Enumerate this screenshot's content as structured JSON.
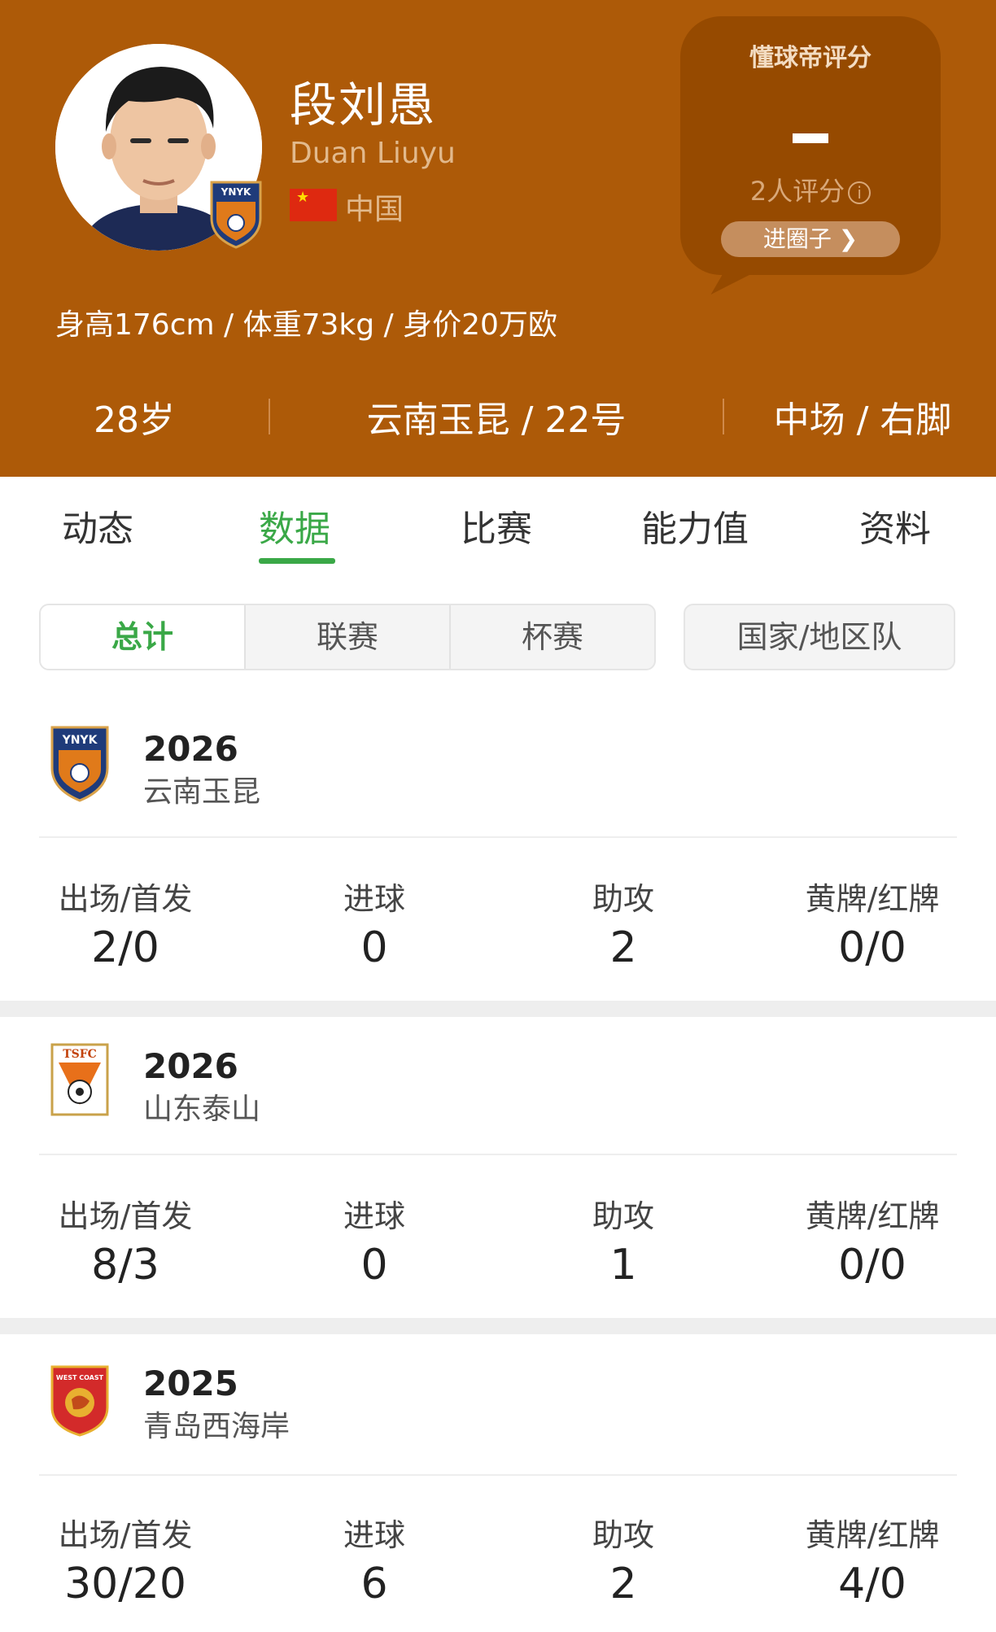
{
  "player": {
    "name_cn": "段刘愚",
    "name_en": "Duan Liuyu",
    "country": "中国",
    "body_stats": "身高176cm / 体重73kg / 身价20万欧",
    "age": "28岁",
    "team_number": "云南玉昆 / 22号",
    "position_foot": "中场 / 右脚",
    "badge_text": "YNYK"
  },
  "rating": {
    "title": "懂球帝评分",
    "value": "-",
    "count": "2人评分",
    "info_symbol": "i",
    "button": "进圈子 ❯"
  },
  "tabs": [
    "动态",
    "数据",
    "比赛",
    "能力值",
    "资料"
  ],
  "active_tab": "数据",
  "segments": [
    "总计",
    "联赛",
    "杯赛"
  ],
  "segment_single": "国家/地区队",
  "stat_labels": {
    "apps": "出场/首发",
    "goals": "进球",
    "assists": "助攻",
    "cards": "黄牌/红牌"
  },
  "seasons": [
    {
      "year": "2026",
      "club": "云南玉昆",
      "badge_text": "YNYK",
      "apps": "2/0",
      "goals": "0",
      "assists": "2",
      "cards": "0/0"
    },
    {
      "year": "2026",
      "club": "山东泰山",
      "badge_text": "TSFC",
      "apps": "8/3",
      "goals": "0",
      "assists": "1",
      "cards": "0/0"
    },
    {
      "year": "2025",
      "club": "青岛西海岸",
      "badge_text": "WEST COAST",
      "apps": "30/20",
      "goals": "6",
      "assists": "2",
      "cards": "4/0"
    }
  ],
  "colors": {
    "header_bg": "#ad5a08",
    "accent_green": "#3aa847",
    "rating_bg": "#964a00"
  }
}
